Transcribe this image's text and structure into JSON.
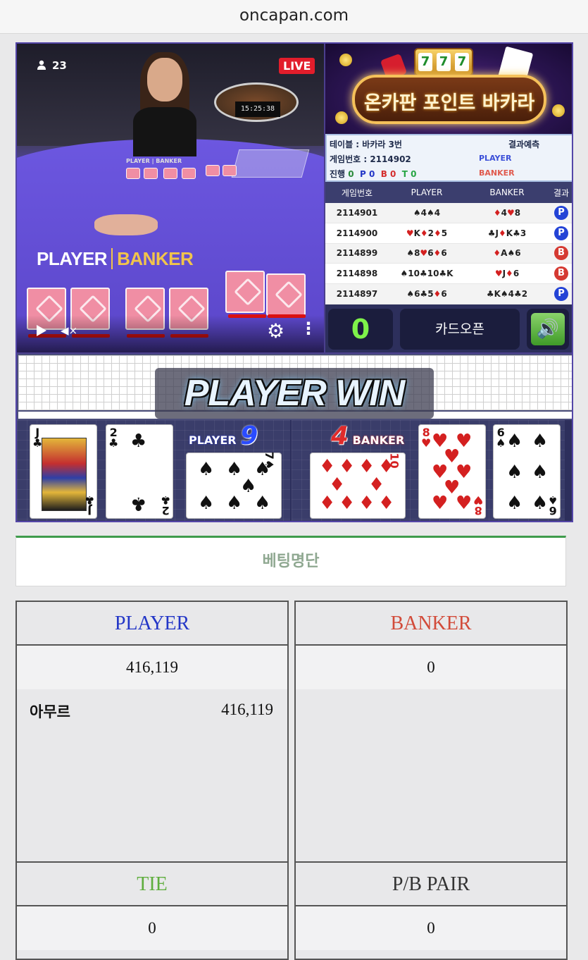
{
  "browser": {
    "url": "oncapan.com"
  },
  "video": {
    "viewers": "23",
    "live_label": "LIVE",
    "clock": "15:25:38",
    "felt_player": "PLAYER",
    "felt_banker": "BANKER",
    "mini_label": "PLAYER | BANKER"
  },
  "logo": {
    "slot": [
      "7",
      "7",
      "7"
    ],
    "banner_text": "온카판 포인트 바카라"
  },
  "info": {
    "table_label": "테이블 : 바카라 3번",
    "game_number_label": "게임번호 : 2114902",
    "progress_label": "진행",
    "progress_total": "0",
    "p_label": "P",
    "p_count": "0",
    "b_label": "B",
    "b_count": "0",
    "t_label": "T",
    "t_count": "0",
    "prediction_title": "결과예측",
    "prediction_player": "PLAYER",
    "prediction_banker": "BANKER"
  },
  "history": {
    "headers": [
      "게임번호",
      "PLAYER",
      "BANKER",
      "결과"
    ],
    "rows": [
      {
        "game": "2114901",
        "player": "♠4♠4",
        "banker": "♦4♥8",
        "result": "P"
      },
      {
        "game": "2114900",
        "player": "♥K♦2♦5",
        "banker": "♣J♦K♣3",
        "result": "P"
      },
      {
        "game": "2114899",
        "player": "♠8♥6♦6",
        "banker": "♦A♠6",
        "result": "B"
      },
      {
        "game": "2114898",
        "player": "♠10♣10♣K",
        "banker": "♥J♦6",
        "result": "B"
      },
      {
        "game": "2114897",
        "player": "♠6♣5♦6",
        "banker": "♣K♠4♣2",
        "result": "P"
      }
    ]
  },
  "controls": {
    "count": "0",
    "card_open": "카드오픈",
    "sound": "🔊"
  },
  "result": {
    "banner": "PLAYER WIN",
    "player_label": "PLAYER",
    "player_score": "9",
    "banker_label": "BANKER",
    "banker_score": "4",
    "player_cards": [
      {
        "rank": "J",
        "suit": "♣"
      },
      {
        "rank": "2",
        "suit": "♣"
      },
      {
        "rank": "7",
        "suit": "♠"
      }
    ],
    "banker_cards": [
      {
        "rank": "10",
        "suit": "♦"
      },
      {
        "rank": "8",
        "suit": "♥"
      },
      {
        "rank": "6",
        "suit": "♠"
      }
    ]
  },
  "betting": {
    "title": "베팅명단",
    "player": {
      "header": "PLAYER",
      "total": "416,119",
      "entries": [
        {
          "name": "아무르",
          "amount": "416,119"
        }
      ]
    },
    "banker": {
      "header": "BANKER",
      "total": "0"
    },
    "tie": {
      "header": "TIE",
      "total": "0"
    },
    "pair": {
      "header": "P/B PAIR",
      "total": "0"
    }
  },
  "colors": {
    "player": "#2336c7",
    "banker": "#d24b3a",
    "tie": "#5fae3e",
    "pair": "#333333",
    "accent_green": "#3e9b4c"
  }
}
